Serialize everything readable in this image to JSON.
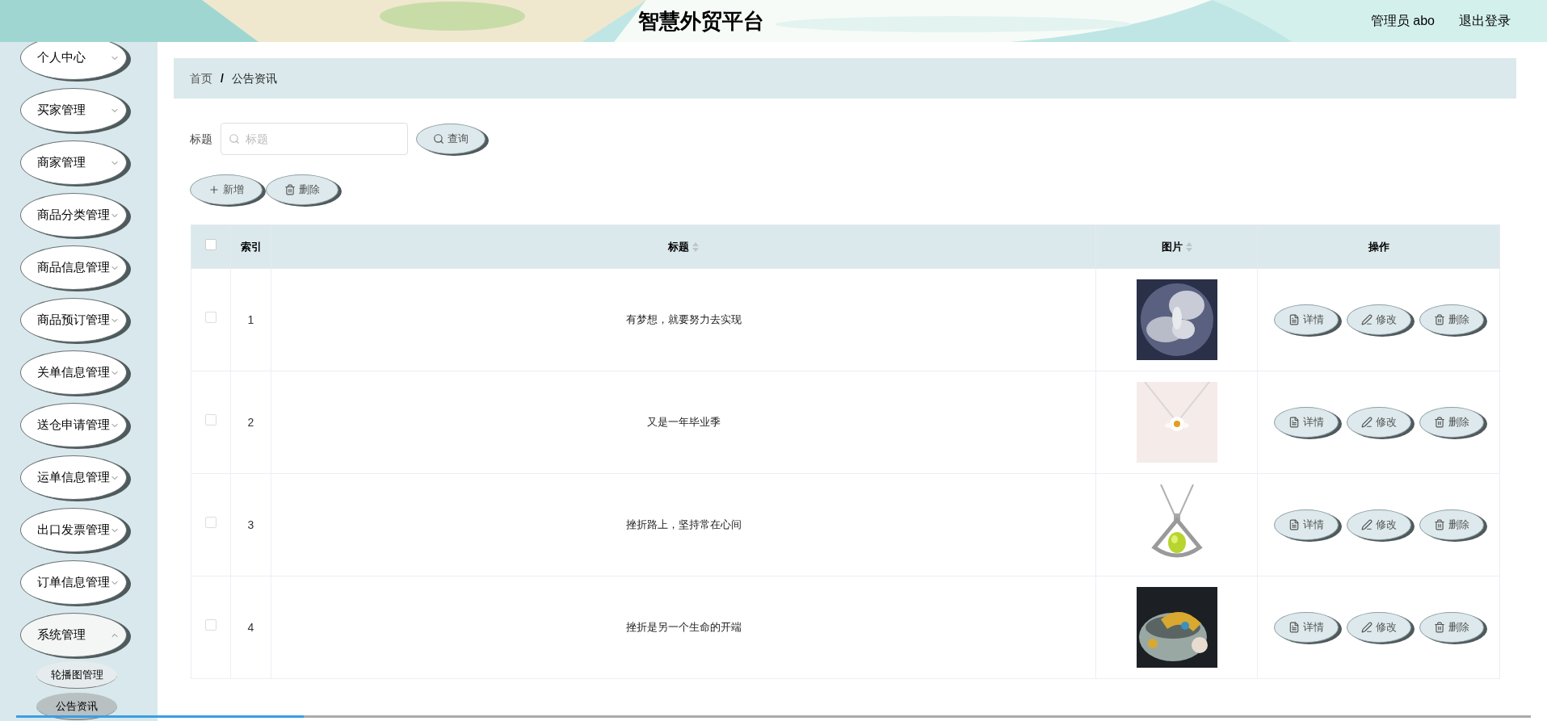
{
  "header": {
    "title": "智慧外贸平台",
    "user": "管理员 abo",
    "logout": "退出登录"
  },
  "sidebar": {
    "items": [
      {
        "label": "个人中心",
        "expanded": false
      },
      {
        "label": "买家管理",
        "expanded": false
      },
      {
        "label": "商家管理",
        "expanded": false
      },
      {
        "label": "商品分类管理",
        "expanded": false
      },
      {
        "label": "商品信息管理",
        "expanded": false
      },
      {
        "label": "商品预订管理",
        "expanded": false
      },
      {
        "label": "关单信息管理",
        "expanded": false
      },
      {
        "label": "送仓申请管理",
        "expanded": false
      },
      {
        "label": "运单信息管理",
        "expanded": false
      },
      {
        "label": "出口发票管理",
        "expanded": false
      },
      {
        "label": "订单信息管理",
        "expanded": false
      },
      {
        "label": "系统管理",
        "expanded": true,
        "children": [
          {
            "label": "轮播图管理",
            "selected": false
          },
          {
            "label": "公告资讯",
            "selected": true
          }
        ]
      }
    ]
  },
  "breadcrumb": [
    "首页",
    "/",
    "公告资讯"
  ],
  "search": {
    "label": "标题",
    "placeholder": "标题",
    "button": "查询"
  },
  "toolbar": [
    "新增",
    "删除"
  ],
  "table": {
    "columns": [
      {
        "label": "索引",
        "sortable": false
      },
      {
        "label": "标题",
        "sortable": true
      },
      {
        "label": "图片",
        "sortable": true
      },
      {
        "label": "操作",
        "sortable": false
      }
    ],
    "select_all": {
      "checked": false
    },
    "rows": [
      {
        "index": "1",
        "title": "有梦想，就要努力去实现",
        "checked": false,
        "picture": {
          "kind": "picture"
        },
        "actions": [
          "详情",
          "修改",
          "删除"
        ]
      },
      {
        "index": "2",
        "title": "又是一年毕业季",
        "checked": false,
        "picture": {
          "kind": "picture"
        },
        "actions": [
          "详情",
          "修改",
          "删除"
        ]
      },
      {
        "index": "3",
        "title": "挫折路上，坚持常在心间",
        "checked": false,
        "picture": {
          "kind": "picture"
        },
        "actions": [
          "详情",
          "修改",
          "删除"
        ]
      },
      {
        "index": "4",
        "title": "挫折是另一个生命的开端",
        "checked": false,
        "picture": {
          "kind": "picture"
        },
        "actions": [
          "详情",
          "修改",
          "删除"
        ]
      }
    ]
  },
  "video_progress": {
    "level": 0.19
  }
}
